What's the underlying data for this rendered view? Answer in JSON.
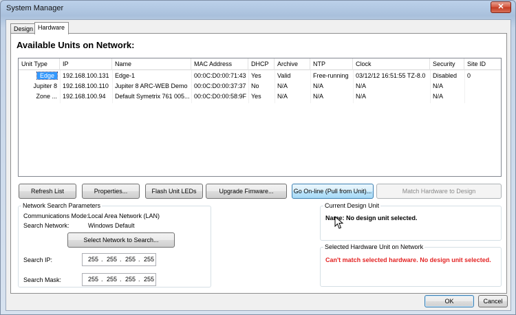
{
  "window": {
    "title": "System Manager",
    "close_glyph": "✕"
  },
  "tabs": [
    {
      "label": "Design",
      "active": false
    },
    {
      "label": "Hardware",
      "active": true
    }
  ],
  "heading": "Available Units on Network:",
  "table": {
    "columns": [
      "Unit Type",
      "IP",
      "Name",
      "MAC Address",
      "DHCP",
      "Archive",
      "NTP",
      "Clock",
      "Security",
      "Site ID"
    ],
    "rows": [
      {
        "selected": true,
        "cells": [
          "Edge",
          "192.168.100.131",
          "Edge-1",
          "00:0C:D0:00:71:43",
          "Yes",
          "Valid",
          "Free-running",
          "03/12/12 16:51:55 TZ-8.0",
          "Disabled",
          "0"
        ]
      },
      {
        "selected": false,
        "cells": [
          "Jupiter 8",
          "192.168.100.110",
          "Jupiter 8 ARC-WEB Demo",
          "00:0C:D0:00:37:37",
          "No",
          "N/A",
          "N/A",
          "N/A",
          "N/A",
          ""
        ]
      },
      {
        "selected": false,
        "cells": [
          "Zone ...",
          "192.168.100.94",
          "Default Symetrix 761 005...",
          "00:0C:D0:00:58:9F",
          "Yes",
          "N/A",
          "N/A",
          "N/A",
          "N/A",
          ""
        ]
      }
    ]
  },
  "buttons": {
    "refresh": "Refresh List",
    "properties": "Properties...",
    "flash": "Flash Unit LEDs",
    "upgrade": "Upgrade Fimware...",
    "go_online": "Go On-line (Pull from Unit)...",
    "match": "Match Hardware to Design",
    "select_network": "Select Network to Search...",
    "ok": "OK",
    "cancel": "Cancel"
  },
  "search": {
    "group_title": "Network Search Parameters",
    "comm_label": "Communications Mode:",
    "comm_value": "Local Area Network (LAN)",
    "network_label": "Search Network:",
    "network_value": "Windows Default",
    "ip_label": "Search IP:",
    "ip": [
      "255",
      "255",
      "255",
      "255"
    ],
    "mask_label": "Search Mask:",
    "mask": [
      "255",
      "255",
      "255",
      "255"
    ],
    "dot": "."
  },
  "current_design": {
    "title": "Current Design Unit",
    "text": "Name: No design unit selected."
  },
  "selected_hw": {
    "title": "Selected Hardware Unit on Network",
    "text": "Can't match selected hardware.  No design unit selected.",
    "text_color": "#e32424"
  },
  "colors": {
    "selection": "#3399ff",
    "hot_button": "#bee6fd"
  }
}
